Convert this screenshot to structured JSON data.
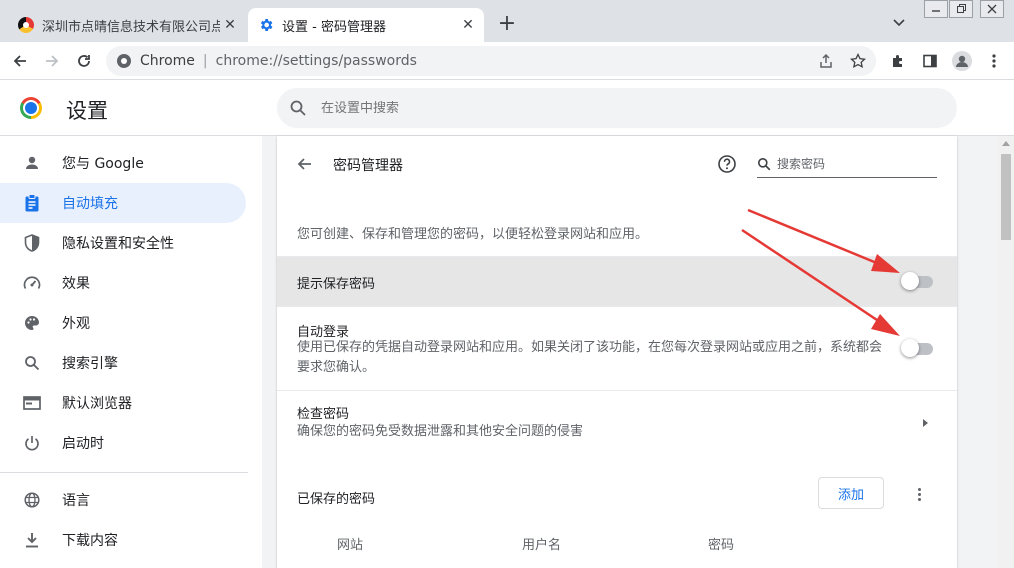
{
  "tabs": [
    {
      "title": "深圳市点晴信息技术有限公司点晴",
      "active": false
    },
    {
      "title": "设置 - 密码管理器",
      "active": true
    }
  ],
  "toolbar": {
    "site_label": "Chrome",
    "url": "chrome://settings/passwords"
  },
  "settings": {
    "title": "设置",
    "search_placeholder": "在设置中搜索"
  },
  "sidebar": {
    "items": [
      {
        "label": "您与 Google",
        "icon": "person-icon"
      },
      {
        "label": "自动填充",
        "icon": "clipboard-icon",
        "active": true
      },
      {
        "label": "隐私设置和安全性",
        "icon": "shield-icon"
      },
      {
        "label": "效果",
        "icon": "speedometer-icon"
      },
      {
        "label": "外观",
        "icon": "palette-icon"
      },
      {
        "label": "搜索引擎",
        "icon": "search-icon"
      },
      {
        "label": "默认浏览器",
        "icon": "browser-window-icon"
      },
      {
        "label": "启动时",
        "icon": "power-icon"
      },
      {
        "label": "语言",
        "icon": "globe-icon"
      },
      {
        "label": "下载内容",
        "icon": "download-icon"
      }
    ]
  },
  "password_manager": {
    "title": "密码管理器",
    "search_placeholder": "搜索密码",
    "description": "您可创建、保存和管理您的密码，以便轻松登录网站和应用。",
    "offer_to_save": {
      "label": "提示保存密码",
      "enabled": false
    },
    "auto_signin": {
      "label": "自动登录",
      "description": "使用已保存的凭据自动登录网站和应用。如果关闭了该功能，在您每次登录网站或应用之前，系统都会要求您确认。",
      "enabled": false
    },
    "check_passwords": {
      "label": "检查密码",
      "description": "确保您的密码免受数据泄露和其他安全问题的侵害"
    },
    "saved_passwords": {
      "label": "已保存的密码",
      "add_button": "添加"
    },
    "columns": [
      "网站",
      "用户名",
      "密码"
    ]
  },
  "colors": {
    "accent": "#1a73e8",
    "arrow": "#e53935",
    "active_nav_bg": "#e8f0fe"
  }
}
